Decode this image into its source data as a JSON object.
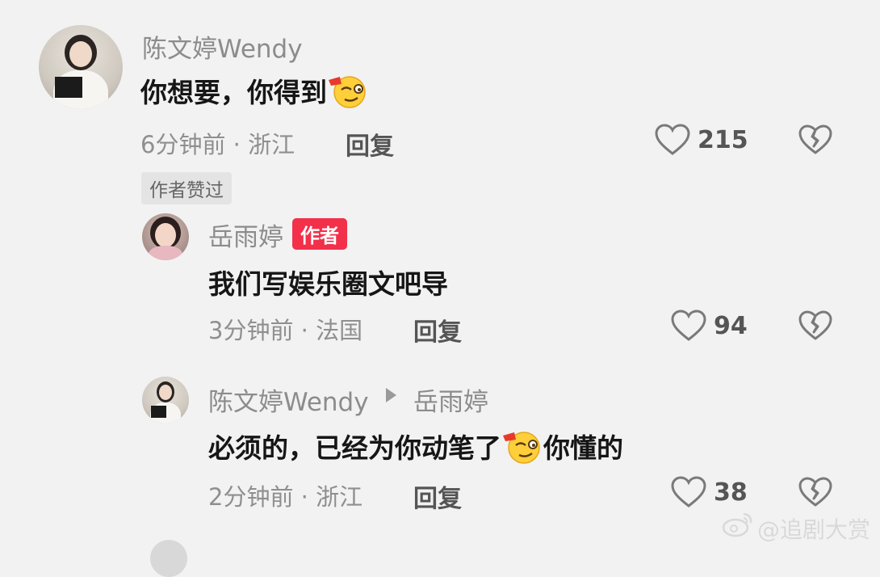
{
  "comments": [
    {
      "username": "陈文婷Wendy",
      "text_before": "你想要，你得到",
      "text_after": "",
      "emoji": "smirk-emoji",
      "time_location": "6分钟前 · 浙江",
      "reply_label": "回复",
      "likes": "215",
      "badge": "作者赞过"
    },
    {
      "username": "岳雨婷",
      "author_badge": "作者",
      "text_before": "我们写娱乐圈文吧导",
      "text_after": "",
      "time_location": "3分钟前 · 法国",
      "reply_label": "回复",
      "likes": "94"
    },
    {
      "username": "陈文婷Wendy",
      "reply_to": "岳雨婷",
      "text_before": "必须的，已经为你动笔了",
      "text_after": "你懂的",
      "emoji": "smirk-emoji",
      "time_location": "2分钟前 · 浙江",
      "reply_label": "回复",
      "likes": "38"
    }
  ],
  "watermark": "@追剧大赏",
  "colors": {
    "author_badge": "#f2304a",
    "background": "#f2f2f2"
  }
}
